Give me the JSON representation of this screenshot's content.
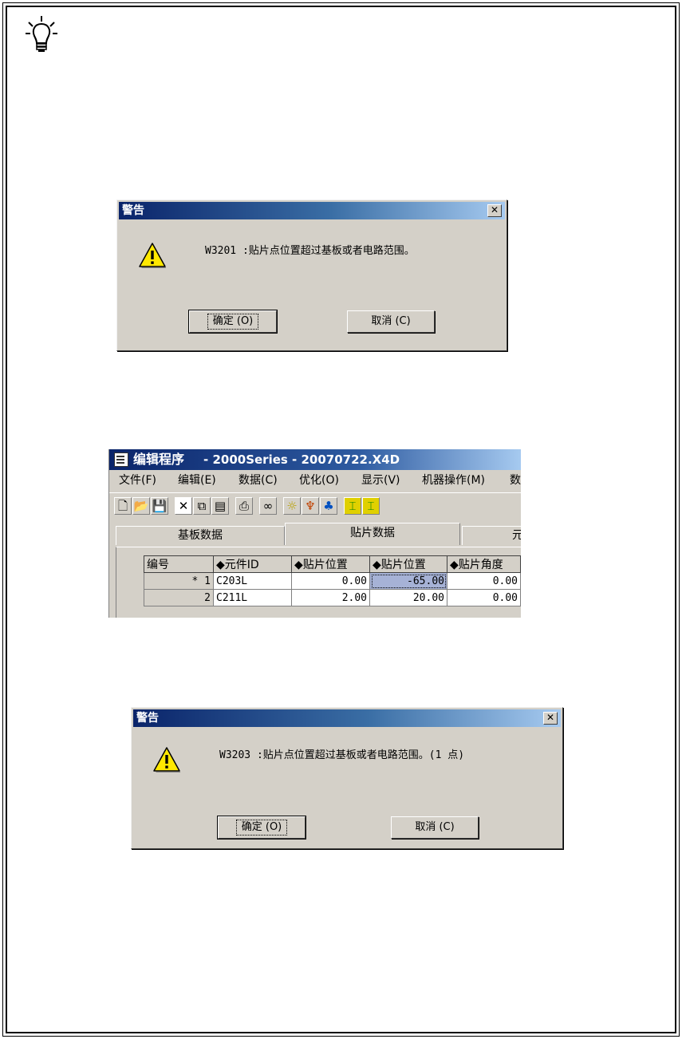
{
  "dialog1": {
    "title": "警告",
    "close": "✕",
    "message": "W3201 :贴片点位置超过基板或者电路范围。",
    "ok_label": "确定 (O)",
    "cancel_label": "取消 (C)"
  },
  "editor": {
    "title_main": "编辑程序",
    "title_rest": "- 2000Series - 20070722.X4D",
    "menus": [
      "文件(F)",
      "编辑(E)",
      "数据(C)",
      "优化(O)",
      "显示(V)",
      "机器操作(M)",
      "数"
    ],
    "tabs": [
      "基板数据",
      "贴片数据",
      "元"
    ],
    "columns": [
      "编号",
      "◆元件ID",
      "◆贴片位置",
      "◆贴片位置",
      "◆贴片角度"
    ],
    "rows": [
      {
        "no": "* 1",
        "id": "C203L",
        "x": "0.00",
        "y": "-65.00",
        "angle": "0.00"
      },
      {
        "no": "2",
        "id": "C211L",
        "x": "2.00",
        "y": "20.00",
        "angle": "0.00"
      }
    ]
  },
  "dialog2": {
    "title": "警告",
    "close": "✕",
    "message": "W3203 :贴片点位置超过基板或者电路范围。(1 点)",
    "ok_label": "确定 (O)",
    "cancel_label": "取消 (C)"
  }
}
